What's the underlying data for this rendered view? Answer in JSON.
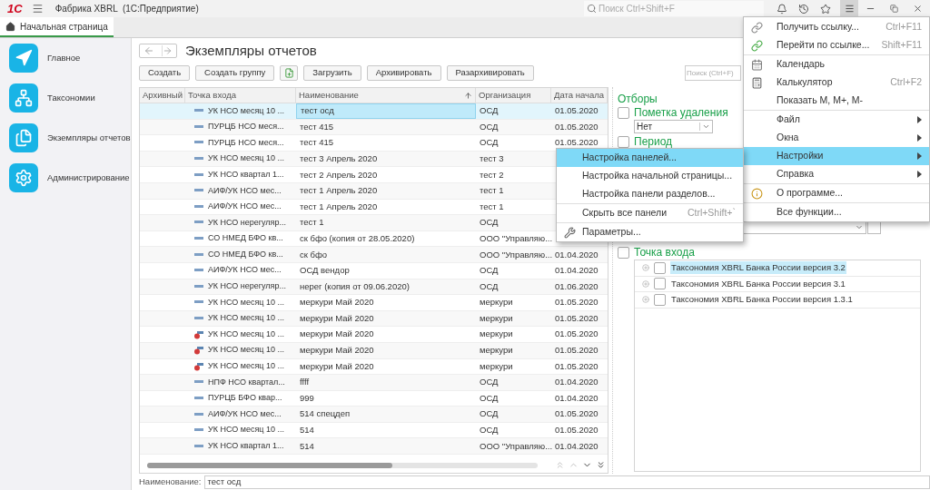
{
  "app_bar": {
    "logo": "1С",
    "title": "Фабрика XBRL  (1С:Предприятие)",
    "search": {
      "placeholder": "Поиск Ctrl+Shift+F"
    }
  },
  "tabs": [
    {
      "label": "Начальная страница",
      "selected": true
    }
  ],
  "sidebar": {
    "items": [
      {
        "label": "Главное",
        "kind": "main"
      },
      {
        "label": "Таксономии",
        "kind": "taxonomy"
      },
      {
        "label": "Экземпляры отчетов",
        "kind": "reports"
      },
      {
        "label": "Администрирование",
        "kind": "admin"
      }
    ]
  },
  "form": {
    "title": "Экземпляры отчетов",
    "toolbar": [
      {
        "label": "Создать",
        "kind": "text"
      },
      {
        "label": "Создать группу",
        "kind": "text"
      },
      {
        "kind": "icon"
      },
      {
        "label": "Загрузить",
        "kind": "text"
      },
      {
        "label": "Архивировать",
        "kind": "text"
      },
      {
        "label": "Разархивировать",
        "kind": "text"
      }
    ],
    "search": {
      "placeholder": "Поиск (Ctrl+F)"
    },
    "table": {
      "columns": [
        "Архивный",
        "Точка входа",
        "Наименование",
        "Организация",
        "Дата начала"
      ],
      "rows": [
        {
          "entry": "УК НСО месяц 10 ...",
          "name": "тест осд",
          "org": "ОСД",
          "date": "01.05.2020",
          "selected": true,
          "marked": false
        },
        {
          "entry": "ПУРЦБ НСО меся...",
          "name": "тест 415",
          "org": "ОСД",
          "date": "01.05.2020",
          "selected": false,
          "marked": false
        },
        {
          "entry": "ПУРЦБ НСО меся...",
          "name": "тест 415",
          "org": "ОСД",
          "date": "01.05.2020",
          "selected": false,
          "marked": false
        },
        {
          "entry": "УК НСО месяц 10 ...",
          "name": "тест 3 Апрель 2020",
          "org": "тест 3",
          "selected": false,
          "marked": false
        },
        {
          "entry": "УК НСО квартал 1...",
          "name": "тест 2 Апрель 2020",
          "org": "тест 2",
          "selected": false,
          "marked": false
        },
        {
          "entry": "АИФ/УК НСО мес...",
          "name": "тест 1  Апрель 2020",
          "org": "тест 1",
          "selected": false,
          "marked": false
        },
        {
          "entry": "АИФ/УК НСО мес...",
          "name": "тест 1  Апрель 2020",
          "org": "тест 1",
          "selected": false,
          "marked": false
        },
        {
          "entry": "УК НСО нерегуляр...",
          "name": "тест 1",
          "org": "ОСД",
          "selected": false,
          "marked": false
        },
        {
          "entry": "СО НМЕД БФО кв...",
          "name": "ск бфо  (копия от 28.05.2020)",
          "org": "ООО \"Управляю...",
          "selected": false,
          "marked": false
        },
        {
          "entry": "СО НМЕД БФО кв...",
          "name": "ск бфо",
          "org": "ООО \"Управляю...",
          "date": "01.04.2020",
          "selected": false,
          "marked": false
        },
        {
          "entry": "АИФ/УК НСО мес...",
          "name": "ОСД вендор",
          "org": "ОСД",
          "date": "01.04.2020",
          "selected": false,
          "marked": false
        },
        {
          "entry": "УК НСО нерегуляр...",
          "name": "нерег (копия от 09.06.2020)",
          "org": "ОСД",
          "date": "01.06.2020",
          "selected": false,
          "marked": false
        },
        {
          "entry": "УК НСО месяц 10 ...",
          "name": "меркури Май 2020",
          "org": "меркури",
          "date": "01.05.2020",
          "selected": false,
          "marked": false
        },
        {
          "entry": "УК НСО месяц 10 ...",
          "name": "меркури Май 2020",
          "org": "меркури",
          "date": "01.05.2020",
          "selected": false,
          "marked": false
        },
        {
          "entry": "УК НСО месяц 10 ...",
          "name": "меркури Май 2020",
          "org": "меркури",
          "date": "01.05.2020",
          "selected": false,
          "marked": true
        },
        {
          "entry": "УК НСО месяц 10 ...",
          "name": "меркури Май 2020",
          "org": "меркури",
          "date": "01.05.2020",
          "selected": false,
          "marked": true
        },
        {
          "entry": "УК НСО месяц 10 ...",
          "name": "меркури Май 2020",
          "org": "меркури",
          "date": "01.05.2020",
          "selected": false,
          "marked": true
        },
        {
          "entry": "НПФ НСО квартал...",
          "name": "ffff",
          "org": "ОСД",
          "date": "01.04.2020",
          "selected": false,
          "marked": false
        },
        {
          "entry": "ПУРЦБ БФО квар...",
          "name": "999",
          "org": "ОСД",
          "date": "01.04.2020",
          "selected": false,
          "marked": false
        },
        {
          "entry": "АИФ/УК НСО мес...",
          "name": "514 спецдеп",
          "org": "ОСД",
          "date": "01.05.2020",
          "selected": false,
          "marked": false
        },
        {
          "entry": "УК НСО месяц 10 ...",
          "name": "514",
          "org": "ОСД",
          "date": "01.05.2020",
          "selected": false,
          "marked": false
        },
        {
          "entry": "УК НСО квартал 1...",
          "name": "514",
          "org": "ООО \"Управляю...",
          "date": "01.04.2020",
          "selected": false,
          "marked": false
        }
      ]
    },
    "name_field": {
      "label": "Наименование:",
      "value": "тест осд"
    },
    "filters": {
      "title": "Отборы",
      "items": [
        {
          "label": "Пометка удаления",
          "checked": false,
          "value": "Нет"
        },
        {
          "label": "Период",
          "checked": false
        },
        {
          "label": "Точка входа",
          "checked": false
        }
      ],
      "tree": [
        {
          "label": "Таксономия XBRL Банка России версия 3.2",
          "checked": false,
          "selected": true
        },
        {
          "label": "Таксономия XBRL Банка России версия 3.1",
          "checked": false,
          "selected": false
        },
        {
          "label": "Таксономия XBRL Банка России версия 1.3.1",
          "checked": false,
          "selected": false
        }
      ]
    }
  },
  "main_menu": {
    "sections": [
      [
        {
          "label": "Получить ссылку...",
          "shortcut": "Ctrl+F11",
          "kind": "link",
          "submenu": false,
          "selected": false
        },
        {
          "label": "Перейти по ссылке...",
          "shortcut": "Shift+F11",
          "kind": "link-go",
          "submenu": false,
          "selected": false
        }
      ],
      [
        {
          "label": "Календарь",
          "kind": "calendar",
          "submenu": false,
          "selected": false
        },
        {
          "label": "Калькулятор",
          "shortcut": "Ctrl+F2",
          "kind": "calculator",
          "submenu": false,
          "selected": false
        },
        {
          "label": "Показать М, М+, М-",
          "kind": "plain",
          "submenu": false,
          "selected": false
        }
      ],
      [
        {
          "label": "Файл",
          "kind": "plain",
          "submenu": true,
          "selected": false
        },
        {
          "label": "Окна",
          "kind": "plain",
          "submenu": true,
          "selected": false
        },
        {
          "label": "Настройки",
          "kind": "plain",
          "submenu": true,
          "selected": true
        },
        {
          "label": "Справка",
          "kind": "plain",
          "submenu": true,
          "selected": false
        }
      ],
      [
        {
          "label": "О программе...",
          "kind": "info",
          "submenu": false,
          "selected": false
        }
      ],
      [
        {
          "label": "Все функции...",
          "kind": "plain",
          "submenu": false,
          "selected": false
        }
      ]
    ]
  },
  "settings_menu": {
    "sections": [
      [
        {
          "label": "Настройка панелей...",
          "kind": "plain",
          "selected": true
        },
        {
          "label": "Настройка начальной страницы...",
          "kind": "plain",
          "selected": false
        },
        {
          "label": "Настройка панели разделов...",
          "kind": "plain",
          "selected": false
        }
      ],
      [
        {
          "label": "Скрыть все панели",
          "kind": "plain",
          "shortcut": "Ctrl+Shift+`",
          "selected": false
        }
      ],
      [
        {
          "label": "Параметры...",
          "kind": "wrench",
          "selected": false
        }
      ]
    ]
  }
}
